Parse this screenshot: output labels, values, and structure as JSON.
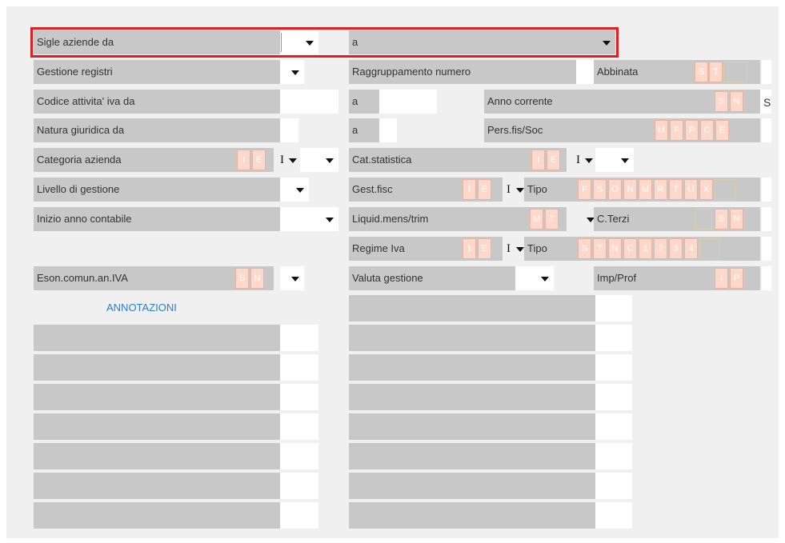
{
  "labels": {
    "sigle_da": "Sigle aziende da",
    "sigle_a": "a",
    "gestione_registri": "Gestione registri",
    "raggruppamento": "Raggruppamento numero",
    "abbinata": "Abbinata",
    "codice_attivita": "Codice attivita' iva da",
    "a1": "a",
    "anno_corrente": "Anno corrente",
    "anno_side": "S",
    "natura_giuridica": "Natura giuridica da",
    "a2": "a",
    "pers_fis_soc": "Pers.fis/Soc",
    "categoria_azienda": "Categoria azienda",
    "cat_statistica": "Cat.statistica",
    "livello_gestione": "Livello di gestione",
    "gest_fisc": "Gest.fisc",
    "tipo1": "Tipo",
    "inizio_anno": "Inizio anno contabile",
    "liquid_mens": "Liquid.mens/trim",
    "c_terzi": "C.Terzi",
    "regime_iva": "Regime Iva",
    "tipo2": "Tipo",
    "eson_comun": "Eson.comun.an.IVA",
    "valuta_gestione": "Valuta gestione",
    "imp_prof": "Imp/Prof",
    "annotazioni": "ANNOTAZIONI"
  },
  "values": {
    "categoria_incl": "I",
    "cat_stat_incl": "I",
    "gest_fisc_incl": "I",
    "regime_iva_incl": "I"
  },
  "buttons": {
    "abbinata": [
      "S",
      "T",
      ""
    ],
    "anno_corrente": [
      "S",
      "N"
    ],
    "pers_fis": [
      "M",
      "F",
      "P",
      "C",
      "E"
    ],
    "categoria": [
      "I",
      "E"
    ],
    "cat_statistica": [
      "I",
      "E"
    ],
    "gest_fisc": [
      "I",
      "E"
    ],
    "gest_tipo": [
      "F",
      "S",
      "O",
      "N",
      "M",
      "R",
      "T",
      "U",
      "X",
      ""
    ],
    "liquid": [
      "M",
      "T"
    ],
    "c_terzi": [
      "",
      "S",
      "N"
    ],
    "regime": [
      "I",
      "E"
    ],
    "regime_tipo": [
      "S",
      "T",
      "N",
      "C",
      "1",
      "2",
      "3",
      "4",
      ""
    ],
    "eson": [
      "S",
      "N"
    ],
    "imp_prof": [
      "I",
      "P"
    ]
  },
  "colors": {
    "highlight": "#e02020",
    "field_grey": "#c8c8c8",
    "button_fill": "#ffd8cc",
    "link": "#2a7fd4"
  }
}
